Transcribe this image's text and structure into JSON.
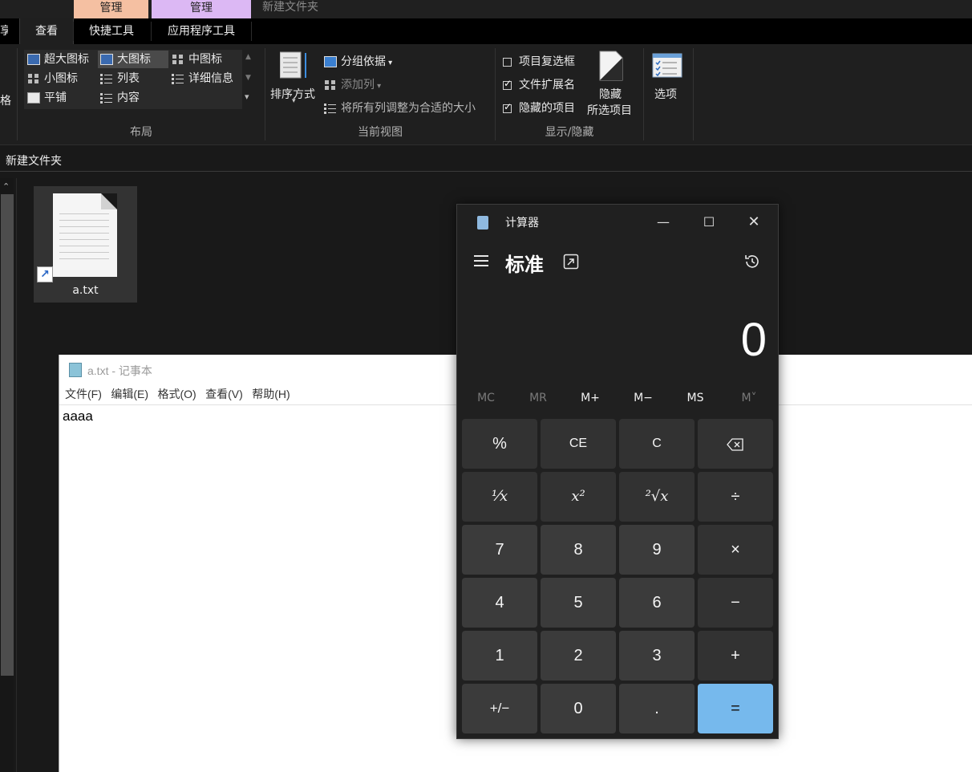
{
  "explorer": {
    "window_title": "新建文件夹",
    "context_tabs": [
      "管理",
      "管理"
    ],
    "tabs": {
      "share": "享",
      "view": "查看",
      "shortcut_tools": "快捷工具",
      "app_tools": "应用程序工具"
    },
    "layout_edge": "格",
    "layout_items": {
      "extra_large": "超大图标",
      "large": "大图标",
      "medium": "中图标",
      "small": "小图标",
      "list": "列表",
      "details": "详细信息",
      "tiles": "平铺",
      "content": "内容"
    },
    "sort": "排序方式",
    "group_by": "分组依据",
    "add_column": "添加列",
    "fit_columns": "将所有列调整为合适的大小",
    "show_hide": {
      "item_checkboxes": {
        "label": "项目复选框",
        "checked": false
      },
      "file_extensions": {
        "label": "文件扩展名",
        "checked": true
      },
      "hidden_items": {
        "label": "隐藏的项目",
        "checked": true
      }
    },
    "hide_selected": [
      "隐藏",
      "所选项目"
    ],
    "options": "选项",
    "group_labels": {
      "layout": "布局",
      "current_view": "当前视图",
      "show_hide": "显示/隐藏"
    },
    "address": "新建文件夹",
    "files": [
      {
        "name": "a.txt",
        "is_shortcut": true
      }
    ]
  },
  "notepad": {
    "title": "a.txt - 记事本",
    "menu": [
      "文件(F)",
      "编辑(E)",
      "格式(O)",
      "查看(V)",
      "帮助(H)"
    ],
    "content": "aaaa"
  },
  "calculator": {
    "title": "计算器",
    "mode": "标准",
    "display": "0",
    "memory": [
      "MC",
      "MR",
      "M+",
      "M−",
      "MS",
      "M˅"
    ],
    "memory_enabled": [
      false,
      false,
      true,
      true,
      true,
      false
    ],
    "keys": [
      [
        "%",
        "CE",
        "C",
        "⌫"
      ],
      [
        "¹⁄x",
        "x²",
        "²√x",
        "÷"
      ],
      [
        "7",
        "8",
        "9",
        "×"
      ],
      [
        "4",
        "5",
        "6",
        "−"
      ],
      [
        "1",
        "2",
        "3",
        "+"
      ],
      [
        "+/−",
        "0",
        ".",
        "="
      ]
    ],
    "accent_color": "#76b9ed"
  }
}
